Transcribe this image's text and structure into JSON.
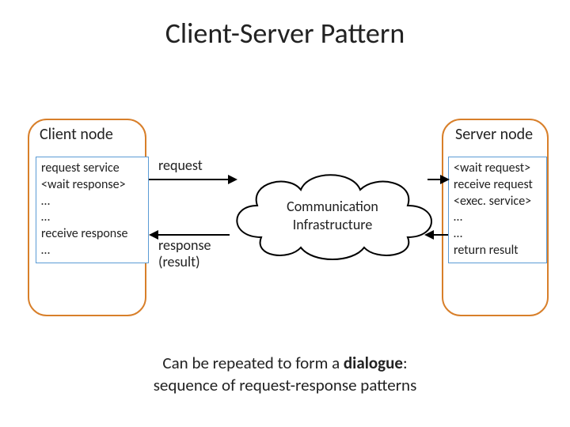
{
  "title": "Client-Server Pattern",
  "client": {
    "label": "Client node",
    "lines": [
      "request service",
      "<wait response>",
      "…",
      "…",
      "receive response",
      "…"
    ]
  },
  "server": {
    "label": "Server node",
    "lines": [
      "<wait request>",
      "receive request",
      "<exec. service>",
      "…",
      "…",
      "return result"
    ]
  },
  "messages": {
    "request": "request",
    "response_l1": "response",
    "response_l2": "(result)"
  },
  "cloud": {
    "l1": "Communication",
    "l2": "Infrastructure"
  },
  "footer": {
    "pre": "Can be repeated to form a ",
    "bold": "dialogue",
    "post": ":",
    "line2": "sequence of request-response patterns"
  }
}
